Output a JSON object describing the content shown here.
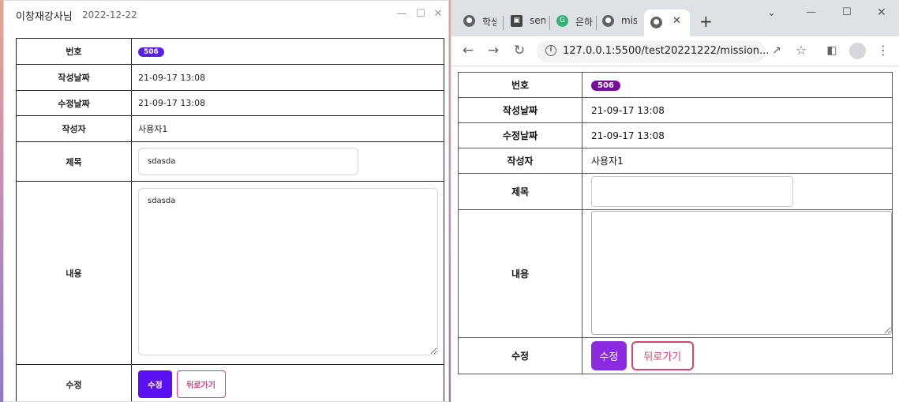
{
  "left_window": {
    "title": "이창재강사님",
    "date": "2022-12-22",
    "form": {
      "number_label": "번호",
      "number_value": "506",
      "created_label": "작성날짜",
      "created_value": "21-09-17 13:08",
      "modified_label": "수정날짜",
      "modified_value": "21-09-17 13:08",
      "author_label": "작성자",
      "author_value": "사용자1",
      "title_label": "제목",
      "title_value": "sdasda",
      "content_label": "내용",
      "content_value": "sdasda",
      "edit_label": "수정",
      "save_button": "수정",
      "back_button": "뒤로가기"
    }
  },
  "browser": {
    "tabs": [
      {
        "label": "학생",
        "icon": "globe-icon"
      },
      {
        "label": "sen",
        "icon": "terminal-icon"
      },
      {
        "label": "은하",
        "icon": "extension-icon"
      },
      {
        "label": "mis",
        "icon": "globe-icon"
      },
      {
        "label": "",
        "icon": "globe-icon",
        "active": true
      }
    ],
    "url": "127.0.0.1:5500/test20221222/mission...",
    "form": {
      "number_label": "번호",
      "number_value": "506",
      "created_label": "작성날짜",
      "created_value": "21-09-17 13:08",
      "modified_label": "수정날짜",
      "modified_value": "21-09-17 13:08",
      "author_label": "작성자",
      "author_value": "사용자1",
      "title_label": "제목",
      "title_value": "",
      "content_label": "내용",
      "content_value": "",
      "edit_label": "수정",
      "save_button": "수정",
      "back_button": "뒤로가기"
    }
  },
  "colors": {
    "left_badge": "#5b1fe8",
    "left_save": "#5b0ff2",
    "left_back": "#e0347e",
    "right_badge": "#7a0aa0",
    "right_save": "#8a2be2",
    "right_back": "#d9436e"
  }
}
